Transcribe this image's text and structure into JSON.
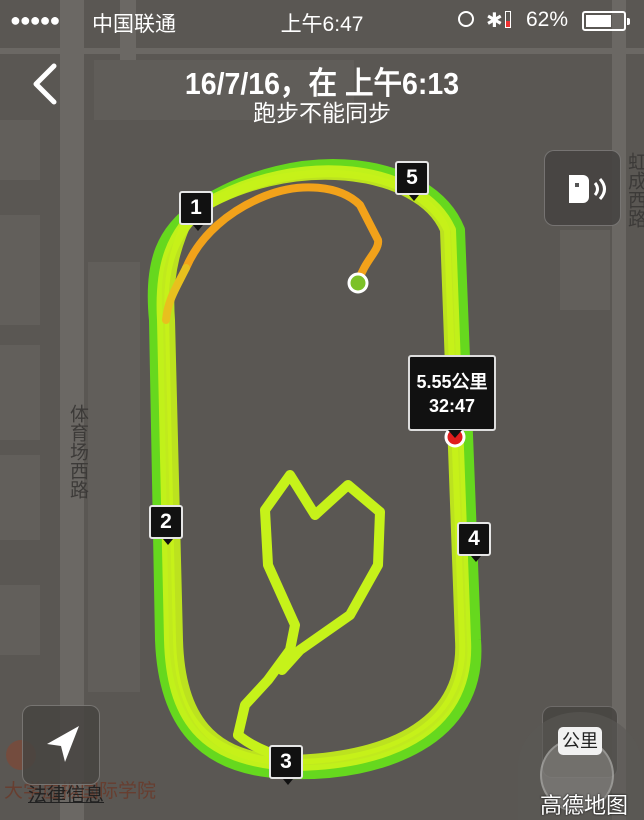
{
  "status_bar": {
    "signal": "●●●●●",
    "carrier": "中国联通",
    "time": "上午6:47",
    "battery_percent": "62%"
  },
  "header": {
    "title": "16/7/16，在 上午6:13",
    "subtitle": "跑步不能同步"
  },
  "run": {
    "distance": "5.55公里",
    "duration": "32:47",
    "km_markers": [
      "1",
      "2",
      "3",
      "4",
      "5"
    ]
  },
  "map": {
    "road_left": "体育场西路",
    "road_right": "虹成西路",
    "poi": "大学虚拟国际学院",
    "legal": "法律信息",
    "provider": "高德地图",
    "unit_toggle": "公里"
  },
  "icons": {
    "back": "chevron-left-icon",
    "voice": "audio-speaker-icon",
    "locate": "location-arrow-icon"
  },
  "colors": {
    "track_main": "#c6f21a",
    "track_alt": "#66d81e",
    "track_start": "#f2a21a",
    "start_dot": "#7cc127",
    "end_dot": "#e01d1d"
  }
}
